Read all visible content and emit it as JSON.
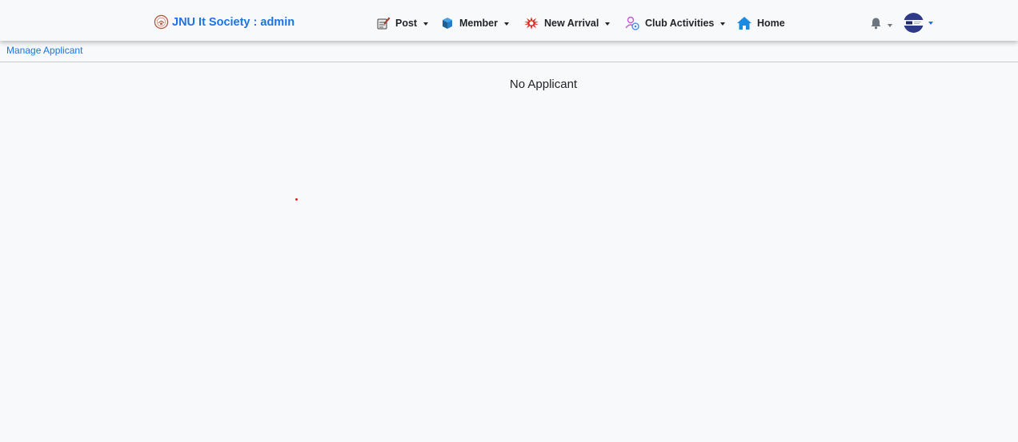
{
  "brand": {
    "title": "JNU It Society : admin",
    "logo_icon": "society-seal-logo"
  },
  "nav": {
    "items": [
      {
        "label": "Post",
        "icon": "post-icon",
        "has_dropdown": true
      },
      {
        "label": "Member",
        "icon": "member-cube-icon",
        "has_dropdown": true
      },
      {
        "label": "New Arrival",
        "icon": "starburst-icon",
        "has_dropdown": true
      },
      {
        "label": "Club Activities",
        "icon": "club-activities-icon",
        "has_dropdown": true
      },
      {
        "label": "Home",
        "icon": "home-icon",
        "has_dropdown": false
      }
    ]
  },
  "user_area": {
    "notifications_icon": "bell-icon",
    "avatar_icon": "avatar"
  },
  "subnav": {
    "link_label": "Manage Applicant"
  },
  "main": {
    "empty_message": "No Applicant"
  },
  "colors": {
    "accent": "#1a73e8",
    "background": "#f8f9fa",
    "text": "#212529"
  }
}
